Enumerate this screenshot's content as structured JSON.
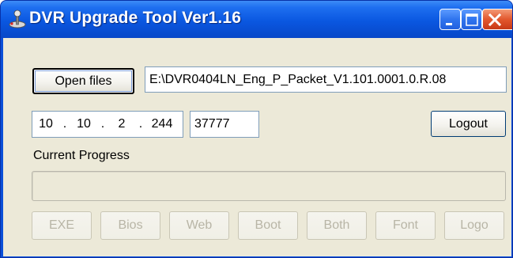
{
  "window": {
    "title": "DVR Upgrade Tool Ver1.16"
  },
  "file": {
    "open_label": "Open files",
    "path": "E:\\DVR0404LN_Eng_P_Packet_V1.101.0001.0.R.08"
  },
  "connection": {
    "ip_octets": [
      "10",
      "10",
      "2",
      "244"
    ],
    "ip_separator": ".",
    "port": "37777",
    "logout_label": "Logout"
  },
  "progress": {
    "label": "Current Progress",
    "value": 0
  },
  "upgrade_buttons": [
    "EXE",
    "Bios",
    "Web",
    "Boot",
    "Both",
    "Font",
    "Logo"
  ],
  "colors": {
    "titlebar": "#0a57e0",
    "client_bg": "#ece9d8",
    "close_button": "#e2572d"
  }
}
